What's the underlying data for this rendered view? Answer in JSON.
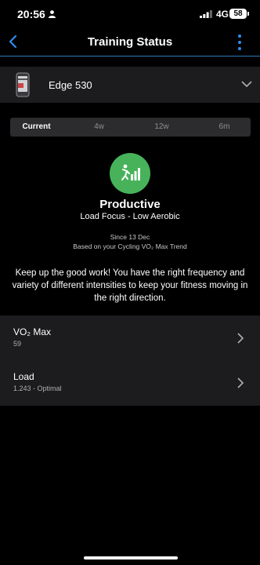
{
  "status_bar": {
    "time": "20:56",
    "network": "4G",
    "battery": "58"
  },
  "header": {
    "title": "Training Status"
  },
  "device": {
    "name": "Edge 530"
  },
  "tabs": [
    {
      "label": "Current",
      "active": true
    },
    {
      "label": "4w"
    },
    {
      "label": "12w"
    },
    {
      "label": "6m"
    }
  ],
  "status": {
    "title": "Productive",
    "subtitle": "Load Focus - Low Aerobic",
    "since": "Since 13 Dec",
    "basis": "Based on your Cycling VO₂ Max Trend",
    "message": "Keep up the good work! You have the right frequency and variety of different intensities to keep your fitness moving in the right direction.",
    "color": "#47b25a"
  },
  "metrics": [
    {
      "label": "VO₂ Max",
      "value": "59"
    },
    {
      "label": "Load",
      "value": "1.243 - Optimal"
    }
  ],
  "colors": {
    "accent": "#2d8cf0",
    "card_bg": "#1c1c1e"
  }
}
